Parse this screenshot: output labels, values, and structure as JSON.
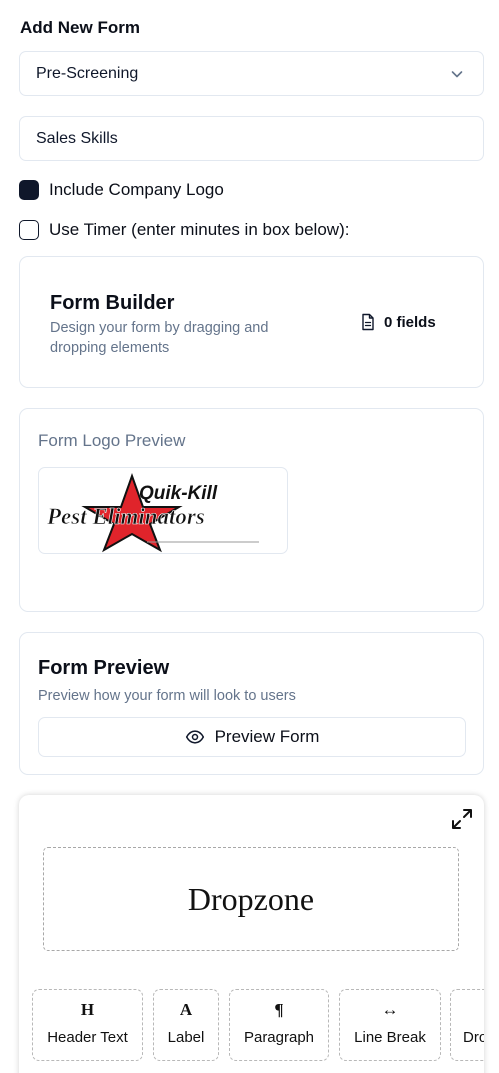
{
  "page": {
    "title": "Add New Form"
  },
  "form_type": {
    "selected": "Pre-Screening"
  },
  "form_name": {
    "value": "Sales Skills"
  },
  "options": {
    "include_logo": {
      "label": "Include Company Logo",
      "checked": true
    },
    "use_timer": {
      "label": "Use Timer (enter minutes in box below):",
      "checked": false
    }
  },
  "builder": {
    "title": "Form Builder",
    "description": "Design your form by dragging and dropping elements",
    "fields_count": "0 fields",
    "icon": "file-icon"
  },
  "logo_preview": {
    "label": "Form Logo Preview",
    "logo_text_top": "Quik-Kill",
    "logo_text_bottom": "Pest Eliminators"
  },
  "preview": {
    "title": "Form Preview",
    "description": "Preview how your form will look to users",
    "button_label": "Preview Form",
    "icon": "eye-icon"
  },
  "dropzone": {
    "label": "Dropzone",
    "icon": "expand-icon"
  },
  "toolbox": [
    {
      "glyph": "H",
      "label": "Header Text"
    },
    {
      "glyph": "A",
      "label": "Label"
    },
    {
      "glyph": "¶",
      "label": "Paragraph"
    },
    {
      "glyph": "↔",
      "label": "Line Break"
    },
    {
      "glyph": "",
      "label": "Dro"
    }
  ],
  "colors": {
    "accent": "#0f172a",
    "muted": "#64748b",
    "border": "#e2e8f0",
    "logo_red": "#e0242b"
  }
}
